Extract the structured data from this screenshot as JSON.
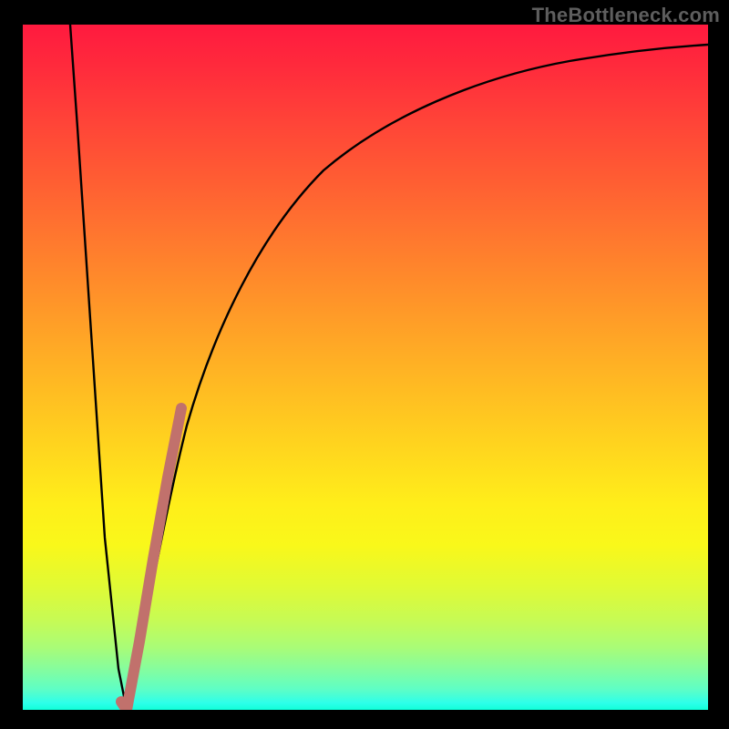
{
  "watermark": "TheBottleneck.com",
  "colors": {
    "frame": "#000000",
    "curve_main": "#000000",
    "curve_highlight": "#c1716c",
    "gradient_top": "#ff1a3f",
    "gradient_bottom": "#10ffd8"
  },
  "chart_data": {
    "type": "line",
    "title": "",
    "xlabel": "",
    "ylabel": "",
    "xlim": [
      0,
      100
    ],
    "ylim": [
      0,
      100
    ],
    "grid": false,
    "legend": false,
    "series": [
      {
        "name": "left-branch",
        "color": "#000000",
        "x": [
          7,
          8,
          10,
          12,
          14,
          15.2
        ],
        "y": [
          100,
          85,
          55,
          25,
          6,
          0
        ]
      },
      {
        "name": "right-branch",
        "color": "#000000",
        "x": [
          15.2,
          16.5,
          18.5,
          21,
          24,
          28,
          33,
          40,
          48,
          58,
          70,
          85,
          100
        ],
        "y": [
          0,
          7,
          19,
          33,
          46,
          58,
          67,
          75,
          81,
          86,
          90,
          93,
          95
        ]
      },
      {
        "name": "highlight-segment",
        "color": "#c1716c",
        "x": [
          14.3,
          15.2,
          17,
          19,
          21.2,
          23.2
        ],
        "y": [
          1.2,
          0,
          10,
          22,
          34,
          44
        ]
      }
    ]
  }
}
